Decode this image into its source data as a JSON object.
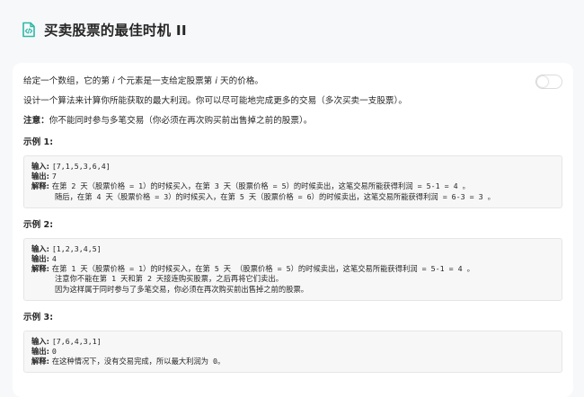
{
  "header": {
    "title": "买卖股票的最佳时机 II",
    "icon": "document-code-icon"
  },
  "description": {
    "p1": {
      "a": "给定一个数组，它的第 ",
      "i1": "i",
      "b": " 个元素是一支给定股票第 ",
      "i2": "i",
      "c": " 天的价格。"
    },
    "p2": "设计一个算法来计算你所能获取的最大利润。你可以尽可能地完成更多的交易（多次买卖一支股票）。",
    "note_label": "注意：",
    "note_text": "你不能同时参与多笔交易（你必须在再次购买前出售掉之前的股票）。"
  },
  "toggle": {
    "state": "off"
  },
  "examples": [
    {
      "title": "示例 1:",
      "input_label": "输入: ",
      "input": "[7,1,5,3,6,4]",
      "output_label": "输出: ",
      "output": "7",
      "explain_label": "解释: ",
      "explain": [
        "在第 2 天（股票价格 = 1）的时候买入，在第 3 天（股票价格 = 5）的时候卖出，这笔交易所能获得利润 = 5-1 = 4 。",
        "随后，在第 4 天（股票价格 = 3）的时候买入，在第 5 天（股票价格 = 6）的时候卖出，这笔交易所能获得利润 = 6-3 = 3 。"
      ]
    },
    {
      "title": "示例 2:",
      "input_label": "输入: ",
      "input": "[1,2,3,4,5]",
      "output_label": "输出: ",
      "output": "4",
      "explain_label": "解释: ",
      "explain": [
        "在第 1 天（股票价格 = 1）的时候买入，在第 5 天 （股票价格 = 5）的时候卖出，这笔交易所能获得利润 = 5-1 = 4 。",
        "注意你不能在第 1 天和第 2 天接连购买股票，之后再将它们卖出。",
        "因为这样属于同时参与了多笔交易，你必须在再次购买前出售掉之前的股票。"
      ]
    },
    {
      "title": "示例 3:",
      "input_label": "输入: ",
      "input": "[7,6,4,3,1]",
      "output_label": "输出: ",
      "output": "0",
      "explain_label": "解释: ",
      "explain": [
        "在这种情况下，没有交易完成，所以最大利润为 0。"
      ]
    }
  ],
  "colors": {
    "background": "#f7f8fa",
    "card": "#ffffff",
    "code_bg": "#f7f7f8",
    "icon_teal": "#2db8a6"
  }
}
